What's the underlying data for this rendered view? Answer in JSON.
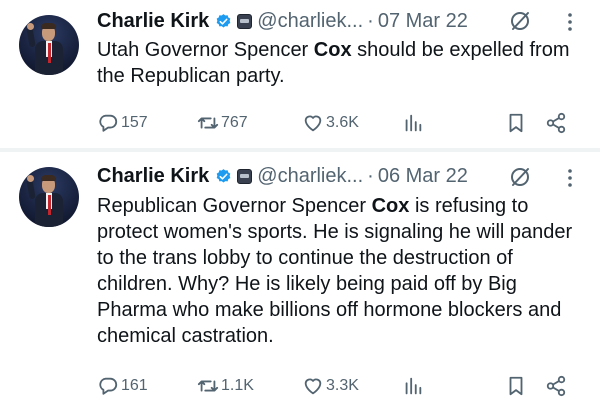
{
  "tweets": [
    {
      "author": "Charlie Kirk",
      "handle": "@charliek...",
      "separator": "·",
      "date": "07 Mar 22",
      "text_segments": [
        {
          "text": "Utah Governor Spencer ",
          "bold": false
        },
        {
          "text": "Cox",
          "bold": true
        },
        {
          "text": " should be expelled from the Republican party.",
          "bold": false
        }
      ],
      "replies": "157",
      "retweets": "767",
      "likes": "3.6K"
    },
    {
      "author": "Charlie Kirk",
      "handle": "@charliek...",
      "separator": "·",
      "date": "06 Mar 22",
      "text_segments": [
        {
          "text": "Republican Governor Spencer ",
          "bold": false
        },
        {
          "text": "Cox",
          "bold": true
        },
        {
          "text": " is refusing to protect women's sports. He is signaling he will pander to the trans lobby to continue the destruction of children. Why? He is likely being paid off by Big Pharma who make billions off hormone blockers and chemical castration.",
          "bold": false
        }
      ],
      "replies": "161",
      "retweets": "1.1K",
      "likes": "3.3K"
    }
  ],
  "colors": {
    "text": "#0f1419",
    "muted": "#536471",
    "verified": "#1d9bf0",
    "divider": "#eff3f4"
  },
  "icons": [
    "verified-badge-icon",
    "affiliate-badge-icon",
    "grok-icon",
    "more-icon",
    "reply-icon",
    "retweet-icon",
    "like-icon",
    "views-icon",
    "bookmark-icon",
    "share-icon"
  ]
}
